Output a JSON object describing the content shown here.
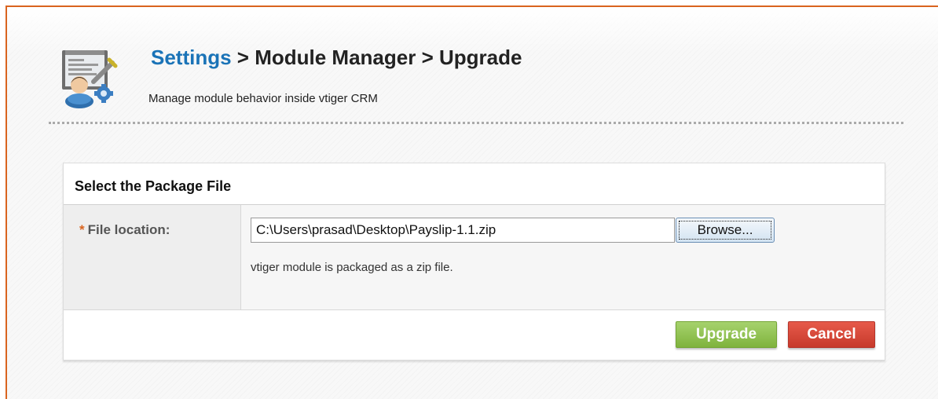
{
  "header": {
    "breadcrumb_link": "Settings",
    "breadcrumb_rest": " > Module Manager > Upgrade",
    "subtitle": "Manage module behavior inside vtiger CRM"
  },
  "panel": {
    "title": "Select the Package File",
    "field": {
      "required_marker": "*",
      "label": "File location:",
      "value": "C:\\Users\\prasad\\Desktop\\Payslip-1.1.zip",
      "browse_label": "Browse...",
      "help": "vtiger module is packaged as a zip file."
    }
  },
  "actions": {
    "upgrade_label": "Upgrade",
    "cancel_label": "Cancel"
  },
  "colors": {
    "accent_orange": "#d9641f",
    "link_blue": "#1a73b7",
    "upgrade_green": "#8cc04f",
    "cancel_red": "#d8473a"
  },
  "icons": {
    "module_manager": "module-manager-icon"
  }
}
